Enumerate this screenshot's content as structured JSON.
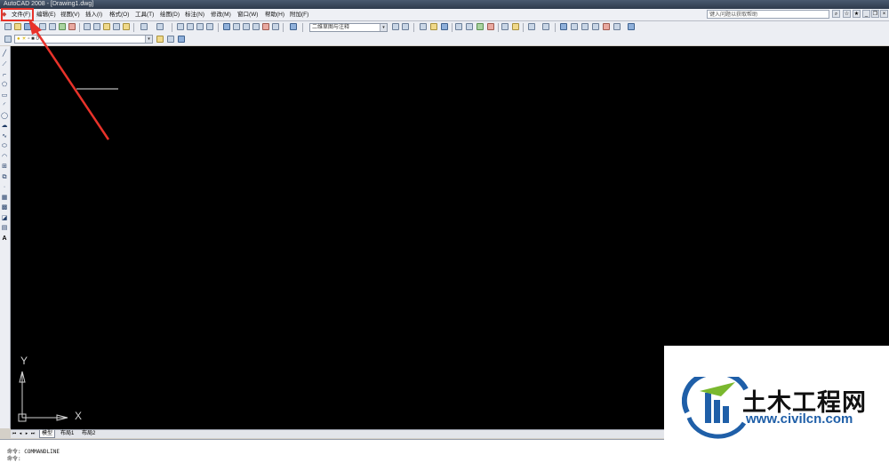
{
  "window": {
    "title": "AutoCAD 2008 - [Drawing1.dwg]"
  },
  "menu": [
    {
      "label": "文件(F)"
    },
    {
      "label": "编辑(E)"
    },
    {
      "label": "视图(V)"
    },
    {
      "label": "插入(I)"
    },
    {
      "label": "格式(O)"
    },
    {
      "label": "工具(T)"
    },
    {
      "label": "绘图(D)"
    },
    {
      "label": "标注(N)"
    },
    {
      "label": "修改(M)"
    },
    {
      "label": "窗口(W)"
    },
    {
      "label": "帮助(H)"
    },
    {
      "label": "附加(F)"
    }
  ],
  "help": {
    "placeholder": "键入问题以获取帮助"
  },
  "toolbar": {
    "workspace": "二维草图与注释",
    "layer": "0"
  },
  "ucs": {
    "x_label": "X",
    "y_label": "Y"
  },
  "tabs": [
    {
      "label": "模型"
    },
    {
      "label": "布局1"
    },
    {
      "label": "布局2"
    }
  ],
  "command": {
    "line1": "命令: COMMANDLINE",
    "line2": "命令:"
  },
  "watermark": {
    "brand": "土木工程网",
    "url": "www.civilcn.com"
  },
  "colors": {
    "canvas": "#000000",
    "annotation": "#e8322a",
    "brand_blue": "#1f5fa8",
    "brand_green": "#7ab82e"
  },
  "left_tools": [
    "line-icon",
    "construction-line-icon",
    "polyline-icon",
    "polygon-icon",
    "rectangle-icon",
    "arc-icon",
    "circle-icon",
    "revision-cloud-icon",
    "spline-icon",
    "ellipse-icon",
    "ellipse-arc-icon",
    "insert-block-icon",
    "make-block-icon",
    "point-icon",
    "hatch-icon",
    "gradient-icon",
    "region-icon",
    "table-icon",
    "multiline-text-icon"
  ]
}
